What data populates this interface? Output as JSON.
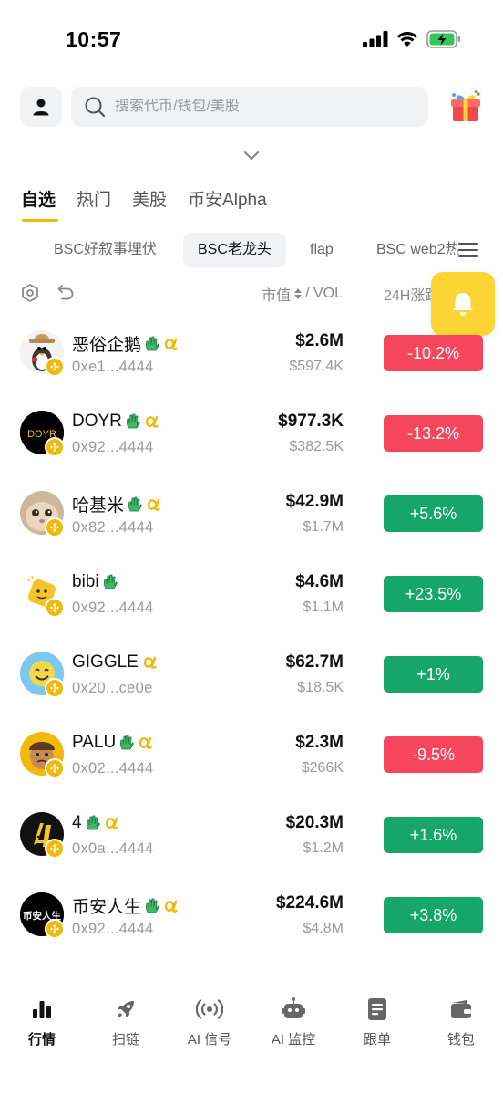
{
  "status": {
    "time": "10:57"
  },
  "search": {
    "placeholder": "搜索代币/钱包/美股"
  },
  "main_tabs": [
    {
      "label": "自选",
      "active": true
    },
    {
      "label": "热门"
    },
    {
      "label": "美股"
    },
    {
      "label": "币安Alpha"
    }
  ],
  "sub_tabs": [
    {
      "label": "BSC好叙事埋伏"
    },
    {
      "label": "BSC老龙头",
      "active": true
    },
    {
      "label": "flap"
    },
    {
      "label": "BSC web2热"
    }
  ],
  "columns": {
    "mcap_vol": "市值",
    "mcap_vol_suffix": "/ VOL",
    "change": "24H涨跌"
  },
  "colors": {
    "accent": "#f0b90b",
    "up": "#16a66a",
    "down": "#f6465d",
    "bell": "#fcd535"
  },
  "tokens": [
    {
      "name": "恶俗企鹅",
      "address": "0xe1...4444",
      "mcap": "$2.6M",
      "vol": "$597.4K",
      "change": "-10.2%",
      "direction": "down",
      "alpha": true,
      "logo_icon": "penguin-icon"
    },
    {
      "name": "DOYR",
      "address": "0x92...4444",
      "mcap": "$977.3K",
      "vol": "$382.5K",
      "change": "-13.2%",
      "direction": "down",
      "alpha": true,
      "logo_text": "DOYR"
    },
    {
      "name": "哈基米",
      "address": "0x82...4444",
      "mcap": "$42.9M",
      "vol": "$1.7M",
      "change": "+5.6%",
      "direction": "up",
      "alpha": true,
      "logo_icon": "cat-icon"
    },
    {
      "name": "bibi",
      "address": "0x92...4444",
      "mcap": "$4.6M",
      "vol": "$1.1M",
      "change": "+23.5%",
      "direction": "up",
      "alpha": false,
      "logo_icon": "bibi-icon"
    },
    {
      "name": "GIGGLE",
      "address": "0x20...ce0e",
      "mcap": "$62.7M",
      "vol": "$18.5K",
      "change": "+1%",
      "direction": "up",
      "alpha": true,
      "no_hand": true,
      "logo_icon": "giggle-icon"
    },
    {
      "name": "PALU",
      "address": "0x02...4444",
      "mcap": "$2.3M",
      "vol": "$266K",
      "change": "-9.5%",
      "direction": "down",
      "alpha": true,
      "logo_icon": "palu-icon"
    },
    {
      "name": "4",
      "address": "0x0a...4444",
      "mcap": "$20.3M",
      "vol": "$1.2M",
      "change": "+1.6%",
      "direction": "up",
      "alpha": true,
      "logo_icon": "four-icon"
    },
    {
      "name": "币安人生",
      "address": "0x92...4444",
      "mcap": "$224.6M",
      "vol": "$4.8M",
      "change": "+3.8%",
      "direction": "up",
      "alpha": true,
      "logo_text": "币安人生"
    }
  ],
  "nav": [
    {
      "label": "行情",
      "icon": "chart-bars-icon",
      "active": true
    },
    {
      "label": "扫链",
      "icon": "rocket-icon"
    },
    {
      "label": "AI 信号",
      "icon": "broadcast-icon"
    },
    {
      "label": "AI 监控",
      "icon": "robot-icon"
    },
    {
      "label": "跟单",
      "icon": "document-icon"
    },
    {
      "label": "钱包",
      "icon": "wallet-icon"
    }
  ]
}
